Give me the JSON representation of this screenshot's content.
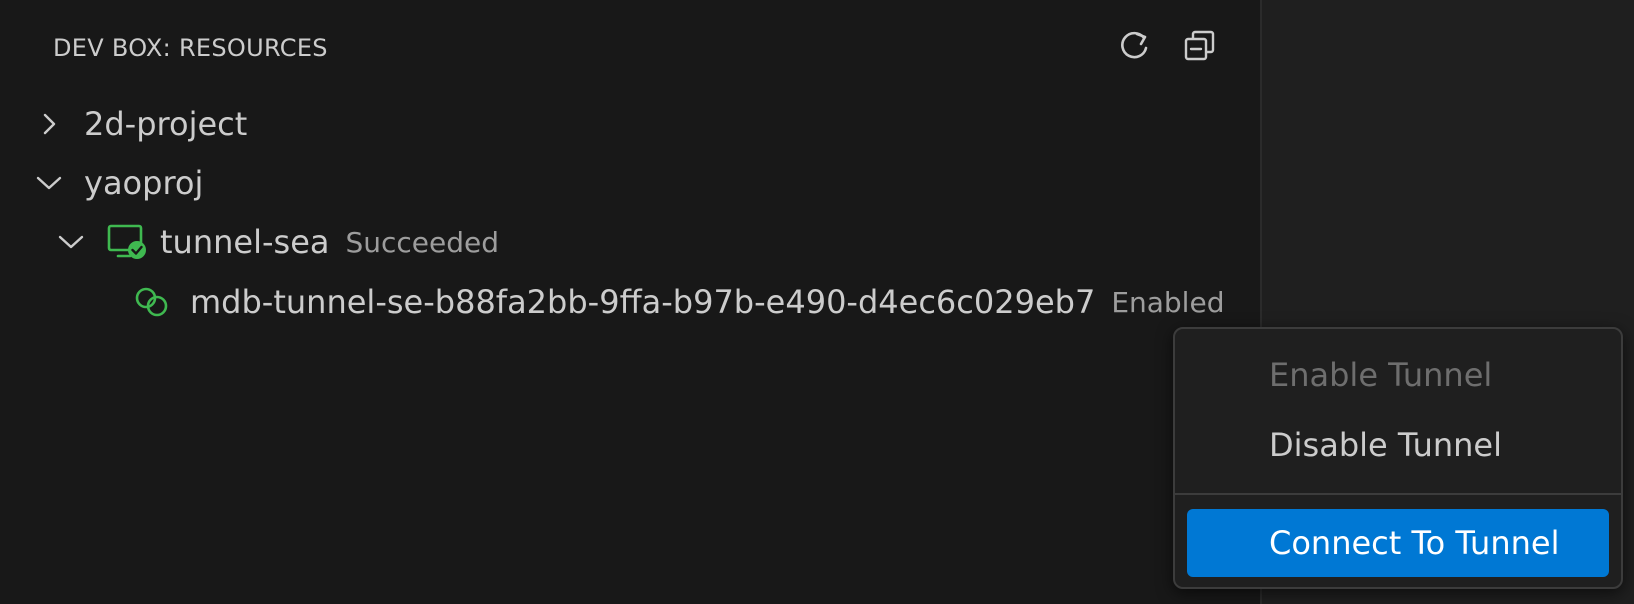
{
  "panel": {
    "title": "DEV BOX: RESOURCES",
    "actions": [
      {
        "name": "refresh",
        "icon": "refresh-icon"
      },
      {
        "name": "collapse-all",
        "icon": "collapse-all-icon"
      }
    ]
  },
  "tree": {
    "projects": [
      {
        "label": "2d-project",
        "expanded": false
      },
      {
        "label": "yaoproj",
        "expanded": true
      }
    ],
    "devbox": {
      "label": "tunnel-sea",
      "status": "Succeeded",
      "icon": "devbox-check-icon",
      "expanded": true
    },
    "tunnel": {
      "label": "mdb-tunnel-se-b88fa2bb-9ffa-b97b-e490-d4ec6c029eb7",
      "status": "Enabled",
      "icon": "link-icon"
    }
  },
  "context_menu": {
    "items": [
      {
        "label": "Enable Tunnel",
        "state": "disabled"
      },
      {
        "label": "Disable Tunnel",
        "state": "normal"
      },
      {
        "label": "Connect To Tunnel",
        "state": "active"
      }
    ]
  },
  "colors": {
    "accent": "#0078d4",
    "success_green": "#3fb950",
    "background": "#181818"
  }
}
